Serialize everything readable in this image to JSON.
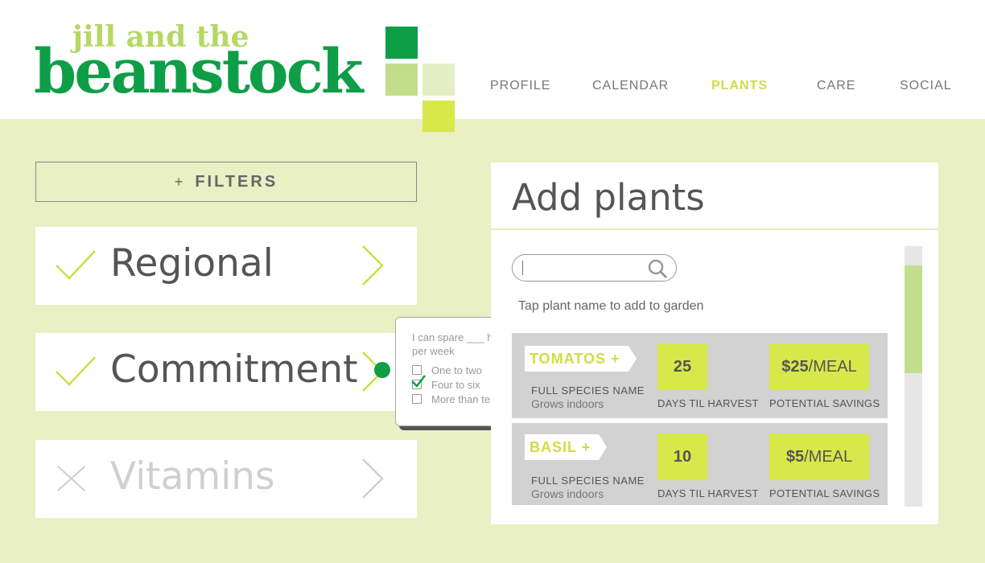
{
  "logo": {
    "top_text": "jill and the",
    "main_text": "beanstock"
  },
  "nav": [
    {
      "label": "PROFILE"
    },
    {
      "label": "CALENDAR"
    },
    {
      "label": "PLANTS"
    },
    {
      "label": "CARE"
    },
    {
      "label": "SOCIAL"
    }
  ],
  "active_nav": "PLANTS",
  "filters": {
    "button_plus": "+",
    "button_label": "FILTERS",
    "items": [
      {
        "label": "Regional",
        "state": "checked",
        "icon": "check-icon"
      },
      {
        "label": "Commitment",
        "state": "checked",
        "icon": "check-icon"
      },
      {
        "label": "Vitamins",
        "state": "unchecked",
        "icon": "x-icon"
      }
    ]
  },
  "commitment_popover": {
    "question": "I can spare ___ hours per week",
    "options": [
      {
        "label": "One to two",
        "checked": false
      },
      {
        "label": "Four to six",
        "checked": true
      },
      {
        "label": "More than ten",
        "checked": false
      }
    ]
  },
  "panel": {
    "title": "Add plants",
    "search_value": "",
    "hint": "Tap plant name to add to garden",
    "plants": [
      {
        "name": "TOMATOS +",
        "species_label": "FULL SPECIES NAME",
        "growth": "Grows indoors",
        "days": "25",
        "days_label": "DAYS TIL HARVEST",
        "savings_amount": "$25",
        "savings_unit": "/MEAL",
        "savings_label": "POTENTIAL SAVINGS"
      },
      {
        "name": "BASIL +",
        "species_label": "FULL SPECIES NAME",
        "growth": "Grows indoors",
        "days": "10",
        "days_label": "DAYS TIL HARVEST",
        "savings_amount": "$5",
        "savings_unit": "/MEAL",
        "savings_label": "POTENTIAL SAVINGS"
      }
    ]
  },
  "colors": {
    "brand_green": "#0e9e47",
    "light_green": "#b5d865",
    "lime": "#d8e84a",
    "background": "#e8f0c4"
  }
}
